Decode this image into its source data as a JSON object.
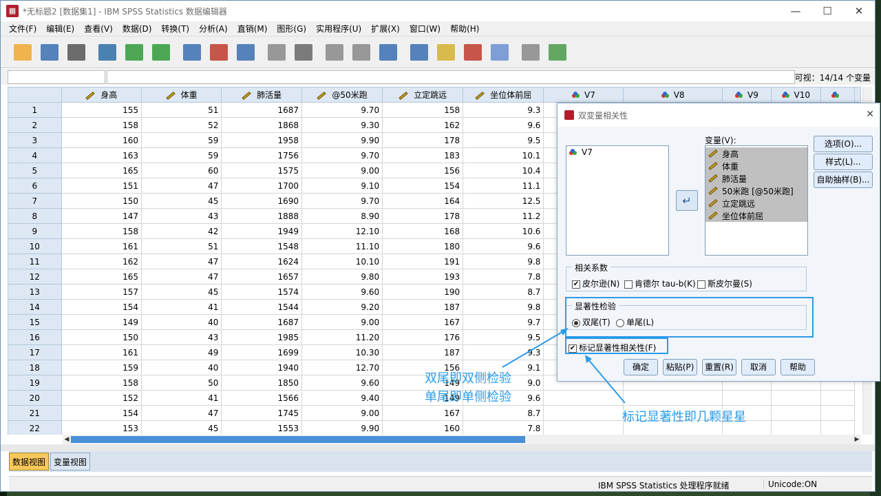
{
  "window": {
    "title": "*无标题2 [数据集1] - IBM SPSS Statistics 数据编辑器",
    "app_icon": "spss-icon"
  },
  "menu": [
    "文件(F)",
    "编辑(E)",
    "查看(V)",
    "数据(D)",
    "转换(T)",
    "分析(A)",
    "直销(M)",
    "图形(G)",
    "实用程序(U)",
    "扩展(X)",
    "窗口(W)",
    "帮助(H)"
  ],
  "toolbar": {
    "icons": [
      "open-folder-icon",
      "save-icon",
      "print-icon",
      "recall-dialog-icon",
      "undo-icon",
      "redo-icon",
      "goto-case-icon",
      "goto-variable-icon",
      "variables-icon",
      "run-descriptives-icon",
      "find-icon",
      "insert-cases-icon",
      "insert-variable-icon",
      "split-file-icon",
      "weight-cases-icon",
      "select-cases-icon",
      "value-labels-icon",
      "use-sets-icon",
      "show-all-variables-icon",
      "spelling-icon"
    ]
  },
  "formula_bar": {
    "visible_count": "可视：14/14 个变量"
  },
  "grid": {
    "columns": [
      {
        "name": "身高",
        "kind": "scale"
      },
      {
        "name": "体重",
        "kind": "scale"
      },
      {
        "name": "肺活量",
        "kind": "scale"
      },
      {
        "name": "@50米跑",
        "kind": "scale"
      },
      {
        "name": "立定跳远",
        "kind": "scale"
      },
      {
        "name": "坐位体前屈",
        "kind": "scale"
      },
      {
        "name": "V7",
        "kind": "nominal"
      },
      {
        "name": "V8",
        "kind": "nominal"
      },
      {
        "name": "V9",
        "kind": "nominal"
      },
      {
        "name": "V10",
        "kind": "nominal"
      },
      {
        "name": "",
        "kind": "nominal"
      }
    ],
    "rows": [
      [
        "1",
        "155",
        "51",
        "1687",
        "9.70",
        "158",
        "9.3"
      ],
      [
        "2",
        "158",
        "52",
        "1868",
        "9.30",
        "162",
        "9.6"
      ],
      [
        "3",
        "160",
        "59",
        "1958",
        "9.90",
        "178",
        "9.5"
      ],
      [
        "4",
        "163",
        "59",
        "1756",
        "9.70",
        "183",
        "10.1"
      ],
      [
        "5",
        "165",
        "60",
        "1575",
        "9.00",
        "156",
        "10.4"
      ],
      [
        "6",
        "151",
        "47",
        "1700",
        "9.10",
        "154",
        "11.1"
      ],
      [
        "7",
        "150",
        "45",
        "1690",
        "9.70",
        "164",
        "12.5"
      ],
      [
        "8",
        "147",
        "43",
        "1888",
        "8.90",
        "178",
        "11.2"
      ],
      [
        "9",
        "158",
        "42",
        "1949",
        "12.10",
        "168",
        "10.6"
      ],
      [
        "10",
        "161",
        "51",
        "1548",
        "11.10",
        "180",
        "9.6"
      ],
      [
        "11",
        "162",
        "47",
        "1624",
        "10.10",
        "191",
        "9.8"
      ],
      [
        "12",
        "165",
        "47",
        "1657",
        "9.80",
        "193",
        "7.8"
      ],
      [
        "13",
        "157",
        "45",
        "1574",
        "9.60",
        "190",
        "8.7"
      ],
      [
        "14",
        "154",
        "41",
        "1544",
        "9.20",
        "187",
        "9.8"
      ],
      [
        "15",
        "149",
        "40",
        "1687",
        "9.00",
        "167",
        "9.7"
      ],
      [
        "16",
        "150",
        "43",
        "1985",
        "11.20",
        "176",
        "9.5"
      ],
      [
        "17",
        "161",
        "49",
        "1699",
        "10.30",
        "187",
        "9.3"
      ],
      [
        "18",
        "159",
        "40",
        "1940",
        "12.70",
        "156",
        "9.1"
      ],
      [
        "19",
        "158",
        "50",
        "1850",
        "9.60",
        "149",
        "9.0"
      ],
      [
        "20",
        "152",
        "41",
        "1566",
        "9.40",
        "149",
        "9.6"
      ],
      [
        "21",
        "154",
        "47",
        "1745",
        "9.00",
        "167",
        "8.7"
      ],
      [
        "22",
        "153",
        "45",
        "1553",
        "9.90",
        "160",
        "7.8"
      ]
    ]
  },
  "tabs": {
    "data_view": "数据视图",
    "variable_view": "变量视图"
  },
  "status": {
    "processor": "IBM SPSS Statistics 处理程序就绪",
    "encoding": "Unicode:ON"
  },
  "dialog": {
    "title": "双变量相关性",
    "source_list": [
      "V7"
    ],
    "variables_label": "变量(V):",
    "variables": [
      "身高",
      "体重",
      "肺活量",
      "50米跑 [@50米跑]",
      "立定跳远",
      "坐位体前屈"
    ],
    "side_buttons": [
      "选项(O)...",
      "样式(L)...",
      "自助抽样(B)..."
    ],
    "coef_group": "相关系数",
    "coef_options": [
      {
        "label": "皮尔逊(N)",
        "checked": true
      },
      {
        "label": "肯德尔 tau-b(K)",
        "checked": false
      },
      {
        "label": "斯皮尔曼(S)",
        "checked": false
      }
    ],
    "sig_group": "显著性检验",
    "sig_options": [
      {
        "label": "双尾(T)",
        "selected": true
      },
      {
        "label": "单尾(L)",
        "selected": false
      }
    ],
    "flag_label": "标记显著性相关性(F)",
    "flag_checked": true,
    "buttons": [
      "确定",
      "粘贴(P)",
      "重置(R)",
      "取消",
      "帮助"
    ]
  },
  "annotations": {
    "two_tail": "双尾即双侧检验",
    "one_tail": "单尾即单侧检验",
    "flag": "标记显著性即几颗星星",
    "color": "#2a9be8"
  }
}
